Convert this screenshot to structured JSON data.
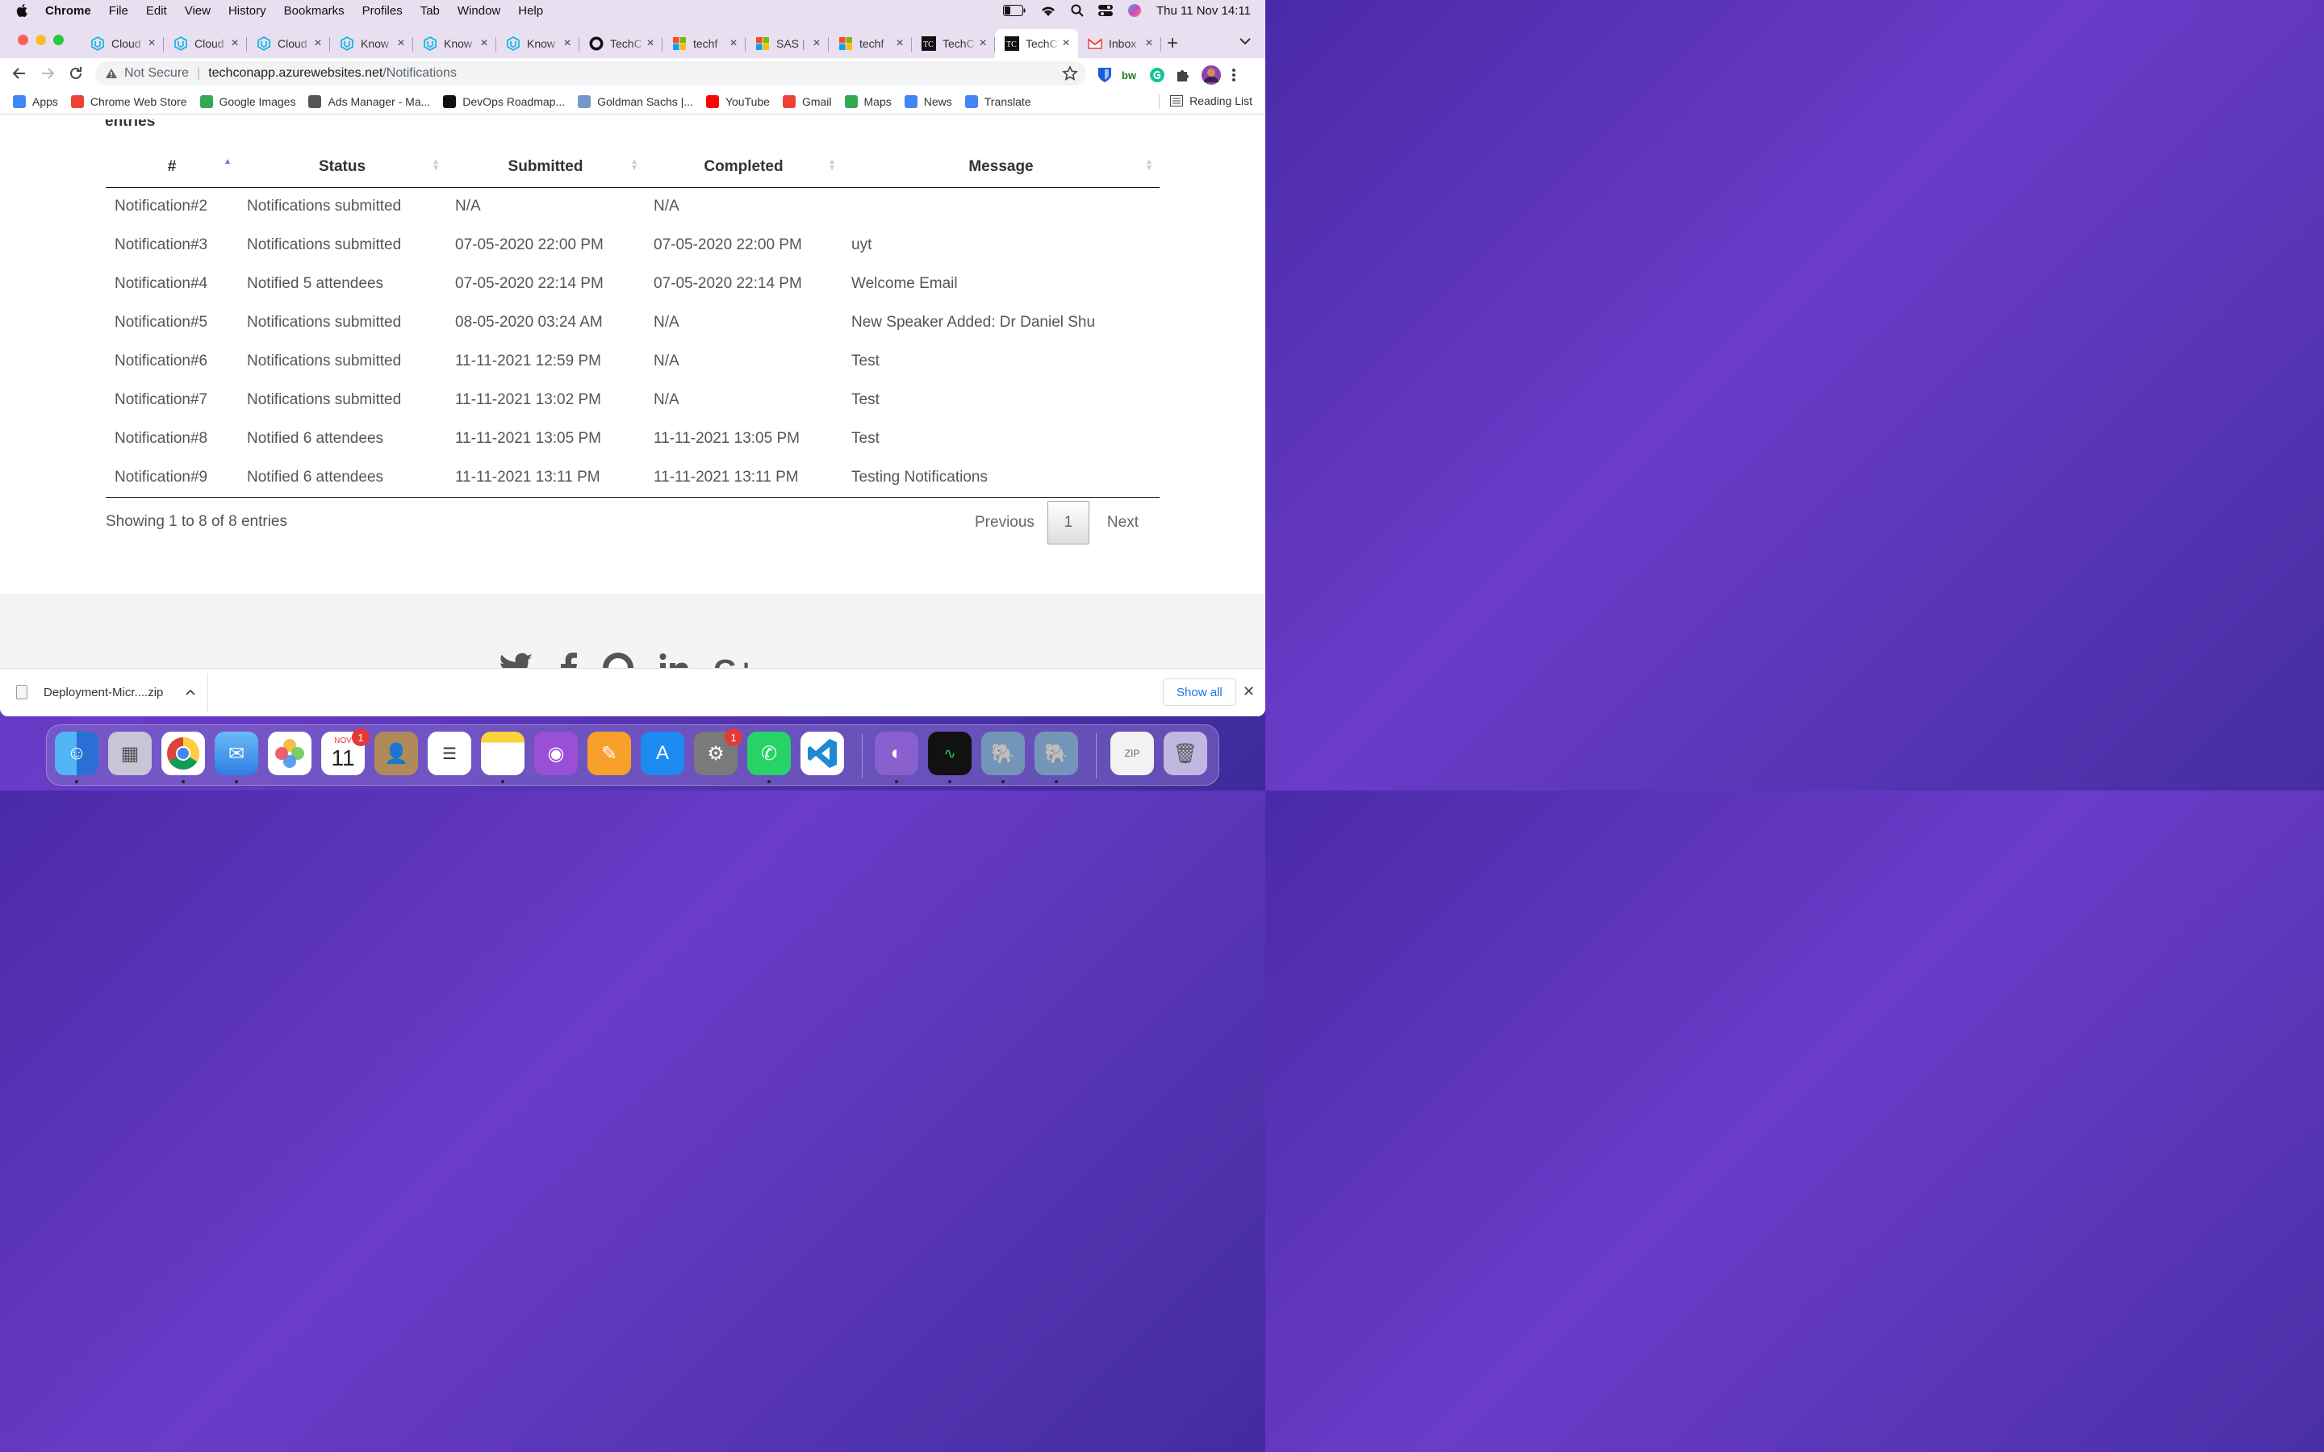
{
  "menubar": {
    "app": "Chrome",
    "items": [
      "File",
      "Edit",
      "View",
      "History",
      "Bookmarks",
      "Profiles",
      "Tab",
      "Window",
      "Help"
    ],
    "datetime": "Thu 11 Nov  14:11"
  },
  "tabs": [
    {
      "label": "Cloud",
      "icon": "udacity-icon"
    },
    {
      "label": "Cloud",
      "icon": "udacity-icon"
    },
    {
      "label": "Cloud",
      "icon": "udacity-icon"
    },
    {
      "label": "Know",
      "icon": "udacity-icon"
    },
    {
      "label": "Know",
      "icon": "udacity-icon"
    },
    {
      "label": "Know",
      "icon": "udacity-icon"
    },
    {
      "label": "TechC",
      "icon": "github-icon"
    },
    {
      "label": "techf",
      "icon": "microsoft-icon"
    },
    {
      "label": "SAS |",
      "icon": "microsoft-icon"
    },
    {
      "label": "techf",
      "icon": "microsoft-icon"
    },
    {
      "label": "TechC",
      "icon": "techconf-icon"
    },
    {
      "label": "TechC",
      "icon": "techconf-icon",
      "active": true
    },
    {
      "label": "Inbox",
      "icon": "gmail-icon"
    }
  ],
  "address": {
    "security": "Not Secure",
    "host": "techconapp.azurewebsites.net",
    "path": "/Notifications"
  },
  "bookmarks": [
    {
      "label": "Apps",
      "color": "#4285f4"
    },
    {
      "label": "Chrome Web Store",
      "color": "#ea4335"
    },
    {
      "label": "Google Images",
      "color": "#34a853"
    },
    {
      "label": "Ads Manager - Ma...",
      "color": "#555555"
    },
    {
      "label": "DevOps Roadmap...",
      "color": "#111111"
    },
    {
      "label": "Goldman Sachs |...",
      "color": "#7399c6"
    },
    {
      "label": "YouTube",
      "color": "#ff0000"
    },
    {
      "label": "Gmail",
      "color": "#ea4335"
    },
    {
      "label": "Maps",
      "color": "#34a853"
    },
    {
      "label": "News",
      "color": "#4285f4"
    },
    {
      "label": "Translate",
      "color": "#4285f4"
    }
  ],
  "reading_list": "Reading List",
  "page": {
    "entries_heading": "entries",
    "columns": [
      "#",
      "Status",
      "Submitted",
      "Completed",
      "Message"
    ],
    "rows": [
      [
        "Notification#2",
        "Notifications submitted",
        "N/A",
        "N/A",
        ""
      ],
      [
        "Notification#3",
        "Notifications submitted",
        "07-05-2020 22:00 PM",
        "07-05-2020 22:00 PM",
        "uyt"
      ],
      [
        "Notification#4",
        "Notified 5 attendees",
        "07-05-2020 22:14 PM",
        "07-05-2020 22:14 PM",
        "Welcome Email"
      ],
      [
        "Notification#5",
        "Notifications submitted",
        "08-05-2020 03:24 AM",
        "N/A",
        "New Speaker Added: Dr Daniel Shu"
      ],
      [
        "Notification#6",
        "Notifications submitted",
        "11-11-2021 12:59 PM",
        "N/A",
        "Test"
      ],
      [
        "Notification#7",
        "Notifications submitted",
        "11-11-2021 13:02 PM",
        "N/A",
        "Test"
      ],
      [
        "Notification#8",
        "Notified 6 attendees",
        "11-11-2021 13:05 PM",
        "11-11-2021 13:05 PM",
        "Test"
      ],
      [
        "Notification#9",
        "Notified 6 attendees",
        "11-11-2021 13:11 PM",
        "11-11-2021 13:11 PM",
        "Testing Notifications"
      ]
    ],
    "info": "Showing 1 to 8 of 8 entries",
    "pager": {
      "previous": "Previous",
      "current": "1",
      "next": "Next"
    }
  },
  "download": {
    "filename": "Deployment-Micr....zip",
    "show_all": "Show all"
  },
  "dock": {
    "calendar_month": "NOV",
    "calendar_day": "11",
    "calendar_badge": "1",
    "settings_badge": "1"
  }
}
